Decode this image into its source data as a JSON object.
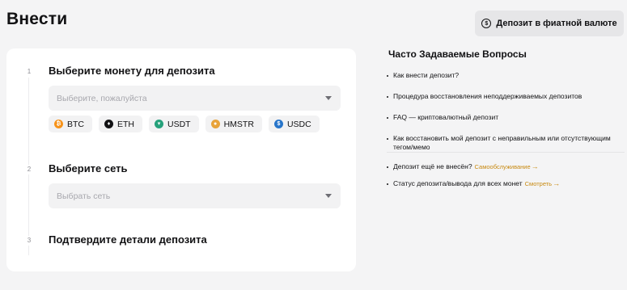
{
  "header": {
    "title": "Внести",
    "fiat_button_label": "Депозит в фиатной валюте"
  },
  "steps": [
    {
      "number": "1",
      "title": "Выберите монету для депозита",
      "select_placeholder": "Выберите, пожалуйста"
    },
    {
      "number": "2",
      "title": "Выберите сеть",
      "select_placeholder": "Выбрать сеть"
    },
    {
      "number": "3",
      "title": "Подтвердите детали депозита"
    }
  ],
  "coins": [
    {
      "label": "BTC",
      "icon": "btc-icon",
      "color": "#f7931a"
    },
    {
      "label": "ETH",
      "icon": "eth-icon",
      "color": "#121214"
    },
    {
      "label": "USDT",
      "icon": "usdt-icon",
      "color": "#26a17b"
    },
    {
      "label": "HMSTR",
      "icon": "hmstr-icon",
      "color": "#e8a33a"
    },
    {
      "label": "USDC",
      "icon": "usdc-icon",
      "color": "#2775ca"
    }
  ],
  "faq": {
    "title": "Часто Задаваемые Вопросы",
    "items": [
      "Как внести депозит?",
      "Процедура восстановления неподдерживаемых депозитов",
      "FAQ — криптовалютный депозит",
      "Как восстановить мой депозит с неправильным или отсутствующим тегом/мемо"
    ],
    "not_credited_text": "Депозит ещё не внесён?",
    "not_credited_link": "Самообслуживание",
    "status_text": "Статус депозита/вывода для всех монет",
    "status_link": "Смотреть"
  },
  "colors": {
    "background": "#f4f4f5",
    "card": "#ffffff",
    "accent_link": "#c88a12"
  }
}
